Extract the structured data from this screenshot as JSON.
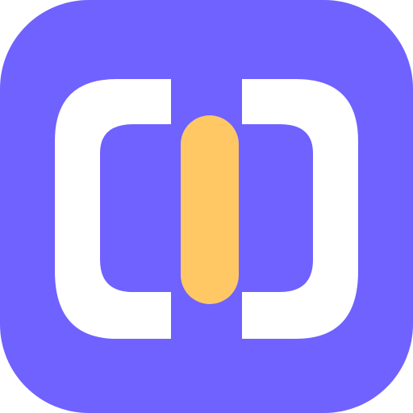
{
  "icon": {
    "name": "bracketed-bar-logo",
    "colors": {
      "background": "#6F62FF",
      "brackets": "#FFFFFF",
      "center_bar": "#FFC865"
    }
  }
}
